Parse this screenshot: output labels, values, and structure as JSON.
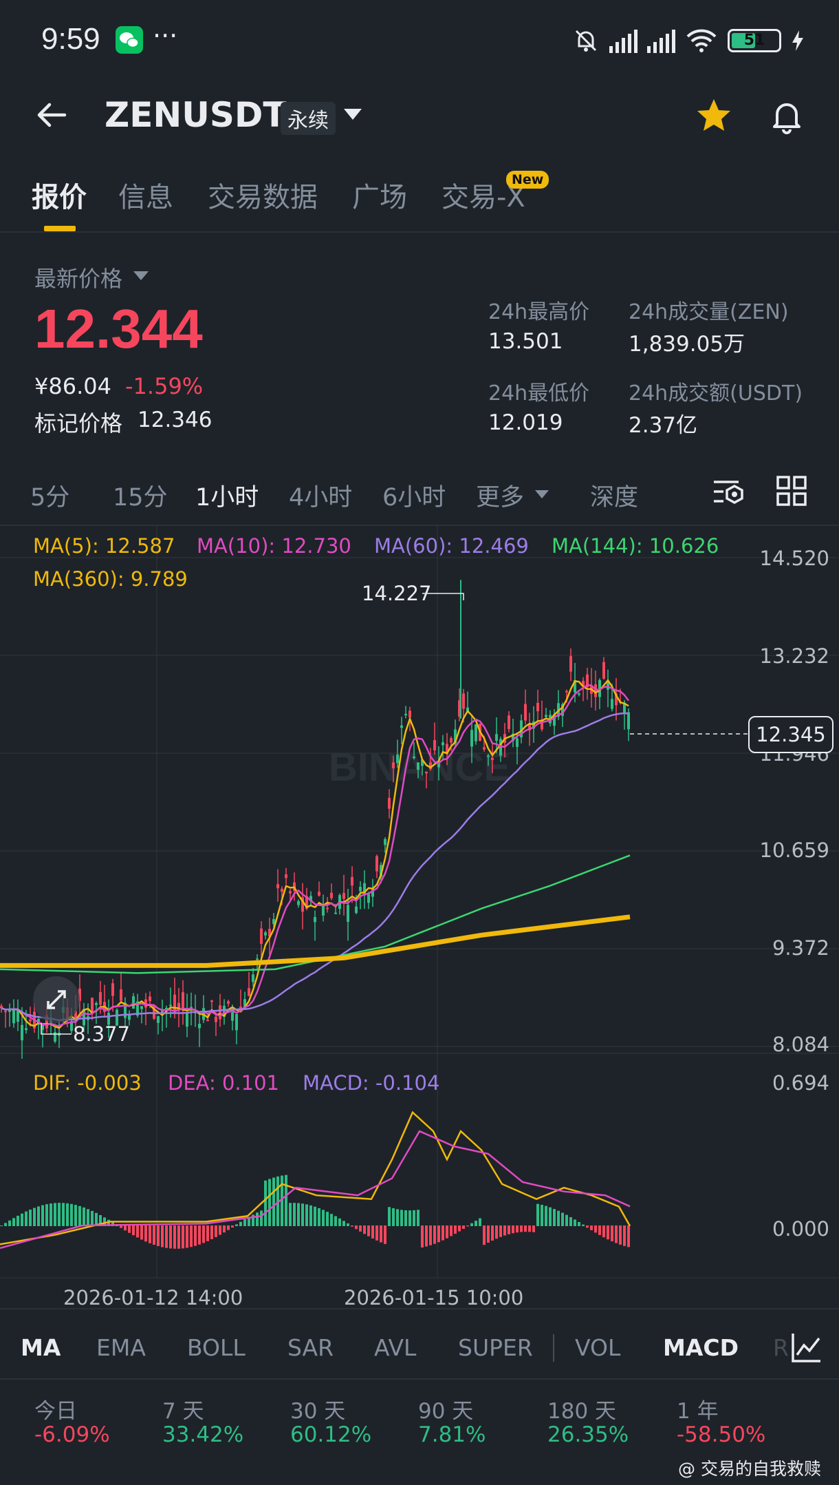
{
  "status_bar": {
    "time": "9:59",
    "battery": "51",
    "battery_level": 0.51
  },
  "header": {
    "symbol": "ZENUSDT",
    "contract_type": "永续"
  },
  "tabs": [
    {
      "label": "报价",
      "active": true
    },
    {
      "label": "信息"
    },
    {
      "label": "交易数据"
    },
    {
      "label": "广场"
    },
    {
      "label": "交易-X",
      "badge": "New"
    }
  ],
  "price": {
    "label": "最新价格",
    "last": "12.344",
    "cny": "¥86.04",
    "change": "-1.59%",
    "mark_label": "标记价格",
    "mark_value": "12.346"
  },
  "stats": {
    "high_label": "24h最高价",
    "high": "13.501",
    "low_label": "24h最低价",
    "low": "12.019",
    "vol_label": "24h成交量(ZEN)",
    "vol": "1,839.05万",
    "turnover_label": "24h成交额(USDT)",
    "turnover": "2.37亿"
  },
  "intervals": [
    {
      "label": "5分"
    },
    {
      "label": "15分"
    },
    {
      "label": "1小时",
      "active": true
    },
    {
      "label": "4小时"
    },
    {
      "label": "6小时"
    },
    {
      "label": "更多"
    },
    {
      "label": "深度"
    }
  ],
  "colors": {
    "up": "#2ebd85",
    "down": "#f6465d",
    "accent": "#f0b90b",
    "ma5": "#f0b90b",
    "ma10": "#e04bc2",
    "ma60": "#9d7de8",
    "ma144": "#3bd671",
    "ma360": "#f0b90b"
  },
  "ma_legend": {
    "ma5": "MA(5): 12.587",
    "ma10": "MA(10): 12.730",
    "ma60": "MA(60): 12.469",
    "ma144": "MA(144): 10.626",
    "ma360": "MA(360): 9.789"
  },
  "price_axis": [
    "14.520",
    "13.232",
    "11.946",
    "10.659",
    "9.372",
    "8.084"
  ],
  "annotations": {
    "high": "14.227",
    "low": "8.377",
    "current": "12.345"
  },
  "macd_legend": {
    "dif": "DIF: -0.003",
    "dea": "DEA: 0.101",
    "macd": "MACD: -0.104"
  },
  "macd_axis": [
    "0.694",
    "0.000"
  ],
  "dates": [
    "2026-01-12 14:00",
    "2026-01-15 10:00"
  ],
  "indicators": [
    {
      "label": "MA",
      "active": true
    },
    {
      "label": "EMA"
    },
    {
      "label": "BOLL"
    },
    {
      "label": "SAR"
    },
    {
      "label": "AVL"
    },
    {
      "label": "SUPER"
    },
    {
      "label": "VOL"
    },
    {
      "label": "MACD",
      "active": true
    },
    {
      "label": "R"
    }
  ],
  "performance": [
    {
      "label": "今日",
      "value": "-6.09%"
    },
    {
      "label": "7 天",
      "value": "33.42%"
    },
    {
      "label": "30 天",
      "value": "60.12%"
    },
    {
      "label": "90 天",
      "value": "7.81%"
    },
    {
      "label": "180 天",
      "value": "26.35%"
    },
    {
      "label": "1 年",
      "value": "-58.50%"
    }
  ],
  "watermark": "@ 交易的自我救赎",
  "chart_logo": "BINANCE"
}
